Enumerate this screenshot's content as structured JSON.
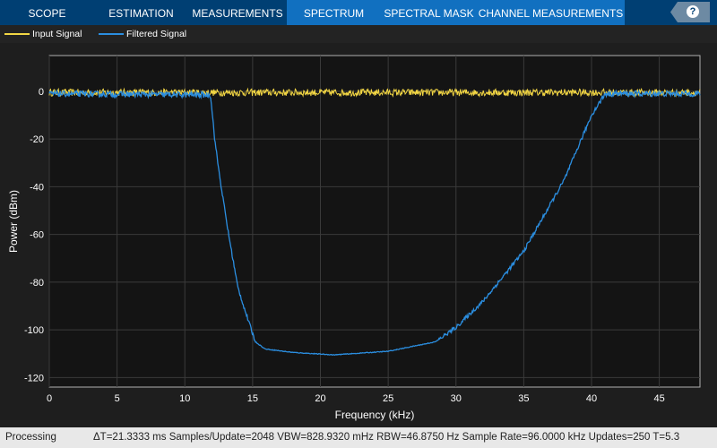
{
  "tabs": [
    {
      "label": "SCOPE",
      "active": false
    },
    {
      "label": "ESTIMATION",
      "active": false
    },
    {
      "label": "MEASUREMENTS",
      "active": false
    },
    {
      "label": "SPECTRUM",
      "active": true
    },
    {
      "label": "SPECTRAL MASK",
      "active": true
    },
    {
      "label": "CHANNEL MEASUREMENTS",
      "active": true
    }
  ],
  "help": {
    "label": "?",
    "icon": "help-icon"
  },
  "legend": [
    {
      "label": "Input Signal",
      "color": "#f2d644"
    },
    {
      "label": "Filtered Signal",
      "color": "#2b8ee0"
    }
  ],
  "status": {
    "state": "Processing",
    "info": "ΔT=21.3333 ms  Samples/Update=2048  VBW=828.9320 mHz  RBW=46.8750 Hz  Sample Rate=96.0000 kHz  Updates=250  T=5.3"
  },
  "chart_data": {
    "type": "line",
    "xlabel": "Frequency (kHz)",
    "ylabel": "Power (dBm)",
    "xlim": [
      0,
      48
    ],
    "ylim": [
      -124,
      15
    ],
    "xticks": [
      0,
      5,
      10,
      15,
      20,
      25,
      30,
      35,
      40,
      45
    ],
    "yticks": [
      0,
      -20,
      -40,
      -60,
      -80,
      -100,
      -120
    ],
    "grid": true,
    "series": [
      {
        "name": "Input Signal",
        "color": "#f2d644",
        "x": [
          0,
          48
        ],
        "y": [
          -0.5,
          -0.5
        ],
        "noise_db": 1.5
      },
      {
        "name": "Filtered Signal",
        "color": "#2b8ee0",
        "x": [
          0,
          11.9,
          12.2,
          12.6,
          13.2,
          13.9,
          14.5,
          15.2,
          15.9,
          18,
          21,
          25,
          28.5,
          30,
          32,
          35,
          38,
          40,
          41,
          48
        ],
        "y": [
          -1,
          -1.5,
          -20,
          -37,
          -59,
          -82,
          -93,
          -105,
          -108,
          -109.5,
          -110.5,
          -109,
          -105,
          -99,
          -88,
          -67,
          -37,
          -10,
          -1,
          -1
        ]
      }
    ]
  }
}
